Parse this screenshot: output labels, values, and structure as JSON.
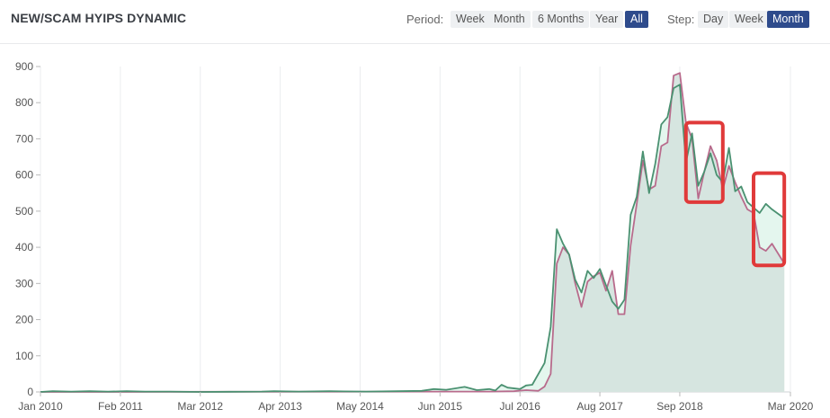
{
  "header": {
    "title": "NEW/SCAM HYIPS DYNAMIC",
    "period_label": "Period:",
    "period_options": [
      "Week",
      "Month",
      "6 Months",
      "Year",
      "All"
    ],
    "period_selected": "All",
    "step_label": "Step:",
    "step_options": [
      "Day",
      "Week",
      "Month"
    ],
    "step_selected": "Month"
  },
  "colors": {
    "active_button": "#2e4b8c",
    "new_line": "#4a9171",
    "scam_line": "#b86b8c",
    "area_fill": "#d5e4de",
    "area_light": "#e4f6ee",
    "highlight_box": "#e03a3a"
  },
  "chart_data": {
    "type": "line",
    "x_tick_labels": [
      "Jan 2010",
      "Feb 2011",
      "Mar 2012",
      "Apr 2013",
      "May 2014",
      "Jun 2015",
      "Jul 2016",
      "Aug 2017",
      "Sep 2018",
      "Mar 2020"
    ],
    "y_tick_labels": [
      "0",
      "100",
      "200",
      "300",
      "400",
      "500",
      "600",
      "700",
      "800",
      "900"
    ],
    "ylim": [
      0,
      900
    ],
    "xlim": [
      "2010-01",
      "2020-03"
    ],
    "grid": "vertical",
    "series": [
      {
        "points": [
          [
            "2010-01",
            0
          ],
          [
            "2010-03",
            2
          ],
          [
            "2010-06",
            1
          ],
          [
            "2010-09",
            2
          ],
          [
            "2010-12",
            1
          ],
          [
            "2011-03",
            2
          ],
          [
            "2011-06",
            1
          ],
          [
            "2011-10",
            1
          ],
          [
            "2012-03",
            0
          ],
          [
            "2013-01",
            1
          ],
          [
            "2013-03",
            2
          ],
          [
            "2013-07",
            1
          ],
          [
            "2013-12",
            2
          ],
          [
            "2014-06",
            1
          ],
          [
            "2014-11",
            2
          ],
          [
            "2015-03",
            3
          ],
          [
            "2015-05",
            8
          ],
          [
            "2015-07",
            6
          ],
          [
            "2015-10",
            14
          ],
          [
            "2015-12",
            5
          ],
          [
            "2016-02",
            8
          ],
          [
            "2016-03",
            4
          ],
          [
            "2016-04",
            20
          ],
          [
            "2016-05",
            12
          ],
          [
            "2016-07",
            8
          ],
          [
            "2016-08",
            18
          ],
          [
            "2016-09",
            20
          ],
          [
            "2016-11",
            80
          ],
          [
            "2016-12",
            180
          ],
          [
            "2017-01",
            450
          ],
          [
            "2017-02",
            410
          ],
          [
            "2017-03",
            380
          ],
          [
            "2017-04",
            310
          ],
          [
            "2017-05",
            275
          ],
          [
            "2017-06",
            335
          ],
          [
            "2017-07",
            315
          ],
          [
            "2017-08",
            340
          ],
          [
            "2017-09",
            295
          ],
          [
            "2017-10",
            250
          ],
          [
            "2017-11",
            230
          ],
          [
            "2017-12",
            255
          ],
          [
            "2018-01",
            490
          ],
          [
            "2018-02",
            540
          ],
          [
            "2018-03",
            665
          ],
          [
            "2018-04",
            550
          ],
          [
            "2018-05",
            630
          ],
          [
            "2018-06",
            740
          ],
          [
            "2018-07",
            760
          ],
          [
            "2018-08",
            840
          ],
          [
            "2018-09",
            850
          ],
          [
            "2018-10",
            635
          ],
          [
            "2018-11",
            715
          ],
          [
            "2018-12",
            570
          ],
          [
            "2019-01",
            610
          ],
          [
            "2019-02",
            660
          ],
          [
            "2019-03",
            600
          ],
          [
            "2019-04",
            580
          ],
          [
            "2019-05",
            675
          ],
          [
            "2019-06",
            555
          ],
          [
            "2019-07",
            568
          ],
          [
            "2019-08",
            525
          ],
          [
            "2019-09",
            510
          ],
          [
            "2019-10",
            495
          ],
          [
            "2019-11",
            520
          ],
          [
            "2019-12",
            505
          ],
          [
            "2020-02",
            480
          ]
        ]
      },
      {
        "points": [
          [
            "2010-01",
            0
          ],
          [
            "2016-02",
            1
          ],
          [
            "2016-06",
            2
          ],
          [
            "2016-08",
            5
          ],
          [
            "2016-10",
            3
          ],
          [
            "2016-11",
            15
          ],
          [
            "2016-12",
            50
          ],
          [
            "2017-01",
            355
          ],
          [
            "2017-02",
            400
          ],
          [
            "2017-03",
            380
          ],
          [
            "2017-04",
            300
          ],
          [
            "2017-05",
            235
          ],
          [
            "2017-06",
            305
          ],
          [
            "2017-07",
            320
          ],
          [
            "2017-08",
            330
          ],
          [
            "2017-09",
            280
          ],
          [
            "2017-10",
            335
          ],
          [
            "2017-11",
            215
          ],
          [
            "2017-12",
            215
          ],
          [
            "2018-01",
            405
          ],
          [
            "2018-02",
            520
          ],
          [
            "2018-03",
            640
          ],
          [
            "2018-04",
            560
          ],
          [
            "2018-05",
            570
          ],
          [
            "2018-06",
            680
          ],
          [
            "2018-07",
            690
          ],
          [
            "2018-08",
            875
          ],
          [
            "2018-09",
            882
          ],
          [
            "2018-10",
            745
          ],
          [
            "2018-11",
            700
          ],
          [
            "2018-12",
            535
          ],
          [
            "2019-01",
            610
          ],
          [
            "2019-02",
            680
          ],
          [
            "2019-03",
            640
          ],
          [
            "2019-04",
            560
          ],
          [
            "2019-05",
            625
          ],
          [
            "2019-06",
            580
          ],
          [
            "2019-07",
            540
          ],
          [
            "2019-08",
            505
          ],
          [
            "2019-09",
            495
          ],
          [
            "2019-10",
            400
          ],
          [
            "2019-11",
            390
          ],
          [
            "2019-12",
            410
          ],
          [
            "2020-02",
            355
          ]
        ]
      }
    ],
    "highlights": [
      {
        "from": "2018-10",
        "to": "2019-04",
        "y_min": 525,
        "y_max": 745
      },
      {
        "from": "2019-09",
        "to": "2020-02",
        "y_min": 350,
        "y_max": 605
      }
    ]
  }
}
